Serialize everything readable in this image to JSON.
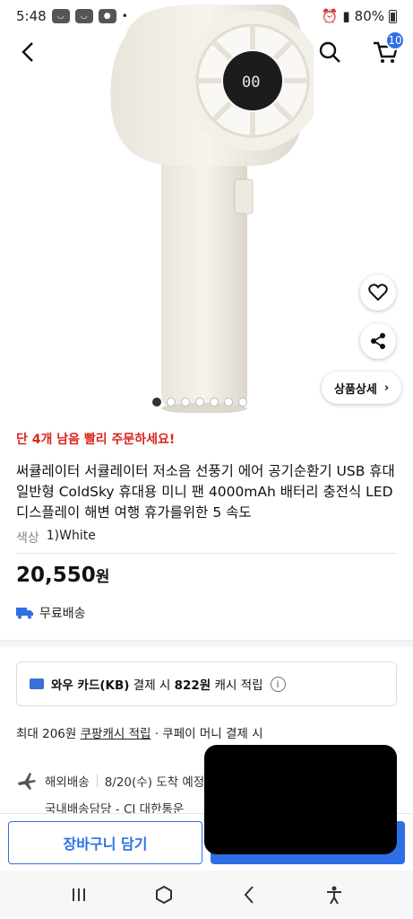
{
  "status_bar": {
    "time": "5:48",
    "battery": "80%"
  },
  "header": {
    "cart_count": "10"
  },
  "gallery": {
    "slides": 7,
    "active_index": 0,
    "detail_button_label": "상품상세"
  },
  "product": {
    "urgency_text": "단 4개 남음 빨리 주문하세요!",
    "title": "써큘레이터 서큘레이터 저소음 선풍기 에어 공기순환기 USB 휴대 일반형 ColdSky 휴대용 미니 팬 4000mAh 배터리 충전식 LED 디스플레이 해변 여행 휴가를위한 5 속도",
    "option_label": "색상",
    "option_value": "1)White",
    "price": "20,550",
    "price_unit": "원",
    "shipping": "무료배송"
  },
  "card_promo": {
    "prefix": "와우 카드(KB)",
    "mid": " 결제 시 ",
    "amount": "822원",
    "suffix": " 캐시 적립"
  },
  "cash": {
    "prefix": "최대 206원 ",
    "link": "쿠팡캐시 적립",
    "suffix": " · 쿠페이 머니 결제 시"
  },
  "delivery": {
    "overseas_label": "해외배송",
    "arrival": "8/20(수) 도착 예정",
    "domestic": "국내배송담당 - CJ 대한통운"
  },
  "actions": {
    "add_to_cart": "장바구니 담기"
  },
  "colors": {
    "accent": "#2f6fe6",
    "urgent": "#d9251d"
  }
}
